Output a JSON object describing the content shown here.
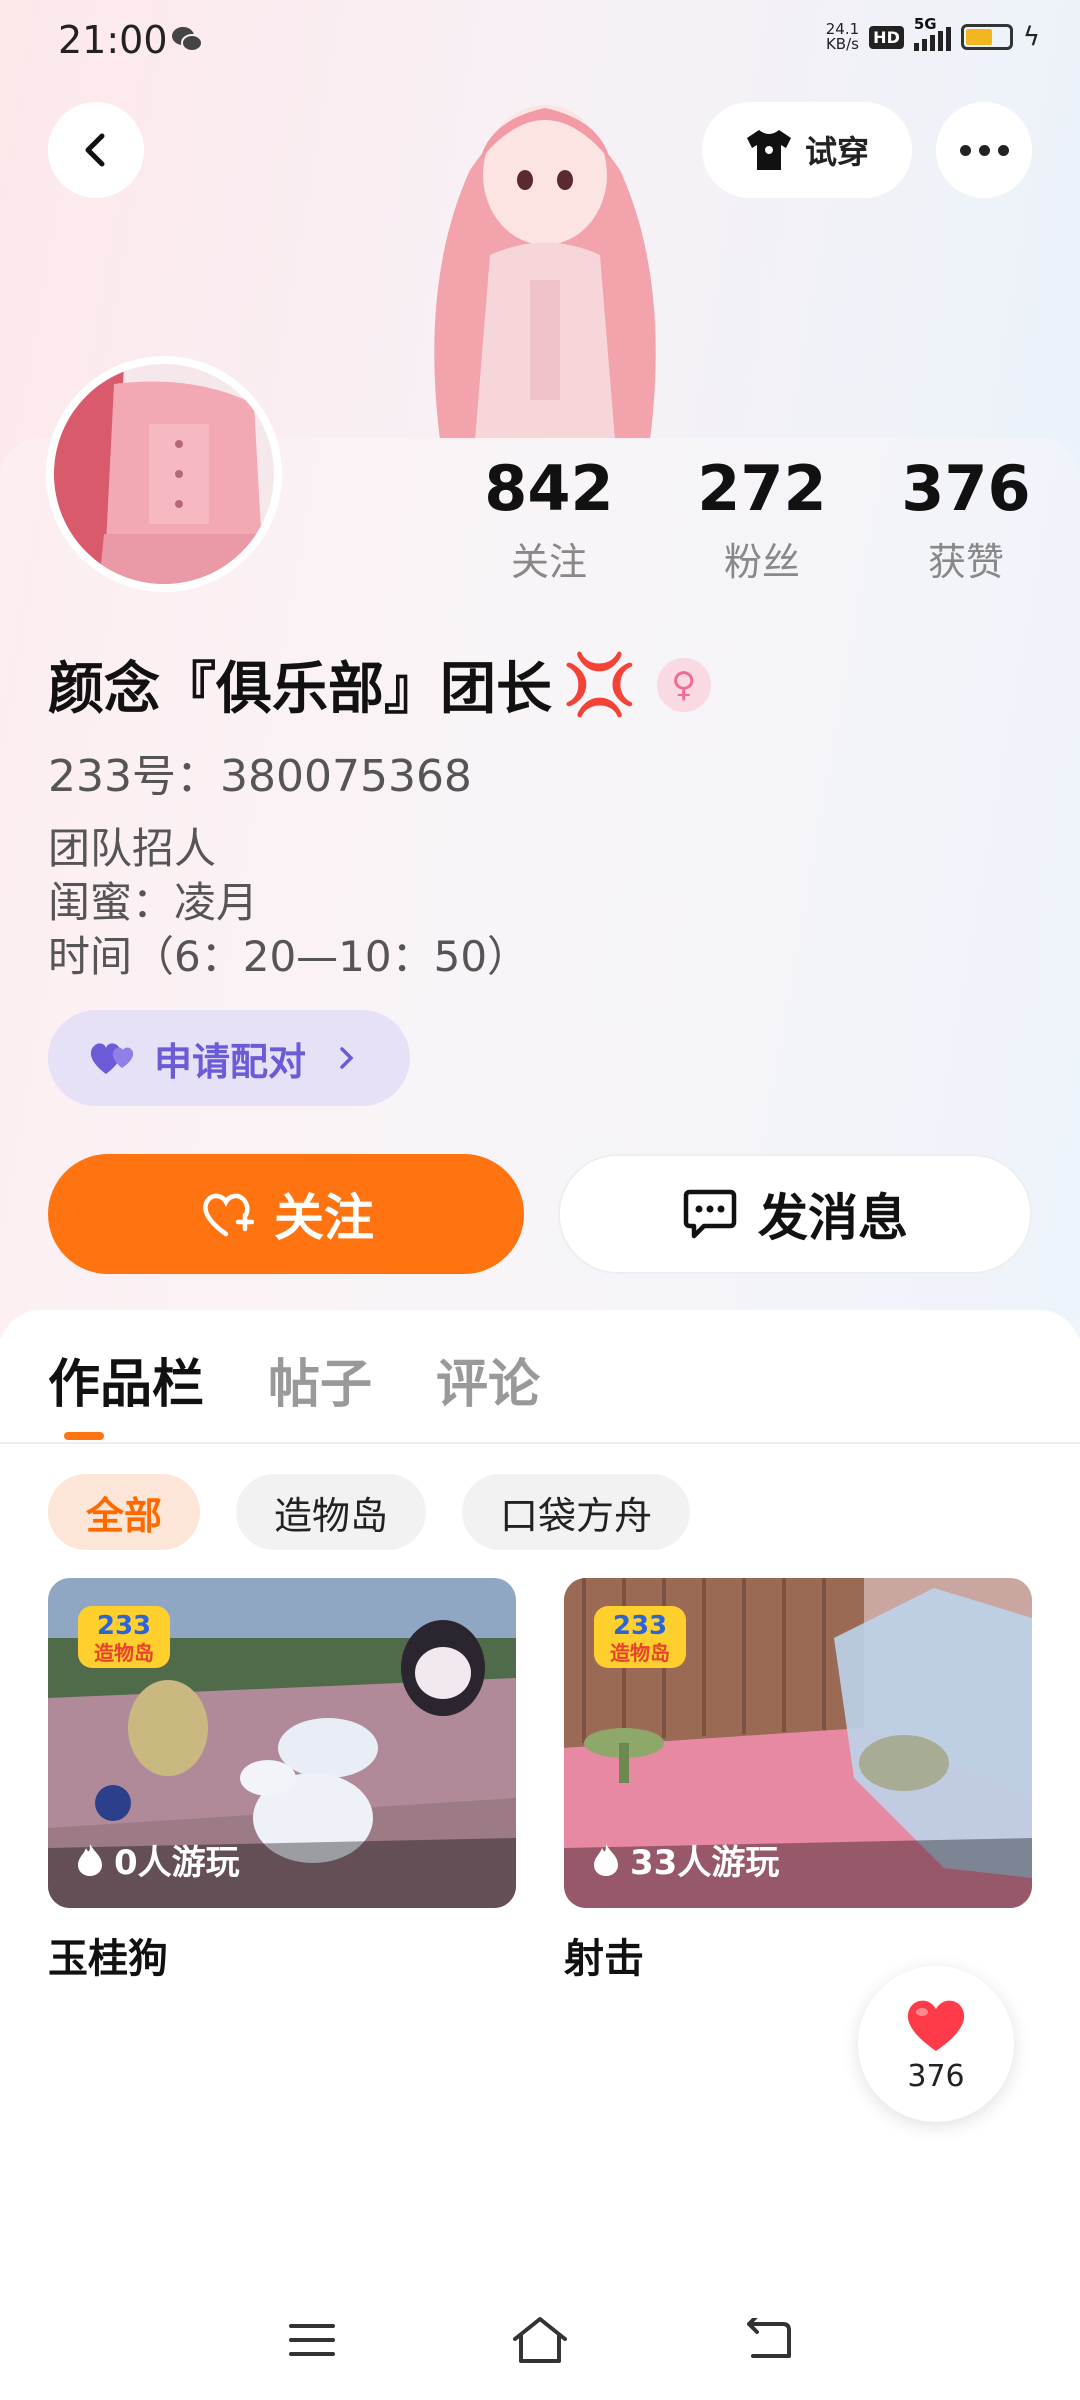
{
  "status_bar": {
    "time": "21:00",
    "net_speed_value": "24.1",
    "net_speed_unit": "KB/s",
    "hd_label": "HD",
    "network_label": "5G",
    "icons": [
      "wechat-icon",
      "hd-icon",
      "signal-icon",
      "battery-icon",
      "charging-icon"
    ]
  },
  "header": {
    "try_on_label": "试穿",
    "icons": [
      "back-icon",
      "shirt-icon",
      "more-icon"
    ]
  },
  "profile": {
    "stats": [
      {
        "value": "842",
        "label": "关注"
      },
      {
        "value": "272",
        "label": "粉丝"
      },
      {
        "value": "376",
        "label": "获赞"
      }
    ],
    "name": "颜念『俱乐部』团长",
    "name_emoji": "💢",
    "gender_icon": "female-icon",
    "uid": "233号：380075368",
    "bio_lines": [
      "团队招人",
      "闺蜜：凌月",
      "时间（6：20—10：50）"
    ],
    "pair_label": "申请配对",
    "follow_label": "关注",
    "message_label": "发消息"
  },
  "tabs": [
    "作品栏",
    "帖子",
    "评论"
  ],
  "active_tab": "作品栏",
  "filters": [
    "全部",
    "造物岛",
    "口袋方舟"
  ],
  "active_filter": "全部",
  "works": [
    {
      "title": "玉桂狗",
      "plays": "0人游玩",
      "badge_top": "233",
      "badge_bottom": "造物岛"
    },
    {
      "title": "射击",
      "plays": "33人游玩",
      "badge_top": "233",
      "badge_bottom": "造物岛"
    }
  ],
  "like_fab": {
    "count": "376"
  },
  "colors": {
    "accent": "#ff7411",
    "pair": "#6c5bd6",
    "like": "#ff3b4a"
  }
}
